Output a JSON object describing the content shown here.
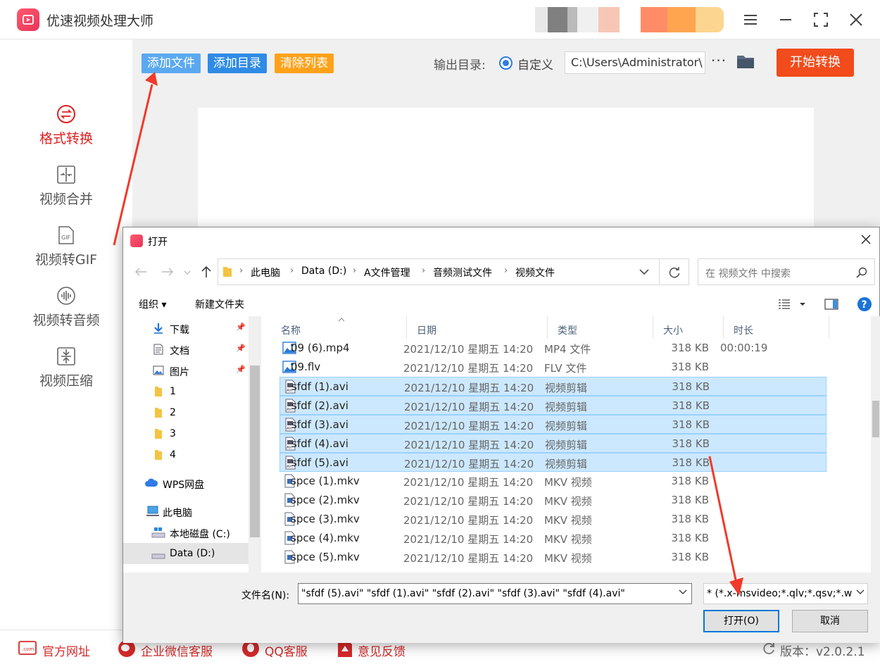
{
  "app": {
    "title": "优速视频处理大师"
  },
  "toolbar": {
    "add_file": "添加文件",
    "add_folder": "添加目录",
    "clear_list": "清除列表",
    "output_label": "输出目录:",
    "custom_label": "自定义",
    "output_path": "C:\\Users\\Administrator\\",
    "more": "···",
    "start": "开始转换"
  },
  "sidebar": {
    "items": [
      {
        "label": "格式转换",
        "icon": "convert-icon",
        "active": true
      },
      {
        "label": "视频合并",
        "icon": "merge-icon",
        "active": false
      },
      {
        "label": "视频转GIF",
        "icon": "gif-icon",
        "active": false
      },
      {
        "label": "视频转音频",
        "icon": "audio-wave-icon",
        "active": false
      },
      {
        "label": "视频压缩",
        "icon": "compress-icon",
        "active": false
      }
    ]
  },
  "footer": {
    "website": "官方网址",
    "wechat": "企业微信客服",
    "qq": "QQ客服",
    "feedback": "意见反馈",
    "version": "版本：v2.0.2.1"
  },
  "dialog": {
    "title": "打开",
    "breadcrumb": [
      "此电脑",
      "Data (D:)",
      "A文件管理",
      "音频测试文件",
      "视频文件"
    ],
    "search_placeholder": "在 视频文件 中搜索",
    "organize": "组织 ▾",
    "new_folder": "新建文件夹",
    "nav": [
      {
        "label": "下载",
        "icon": "download-icon",
        "pinned": true
      },
      {
        "label": "文档",
        "icon": "document-icon",
        "pinned": true
      },
      {
        "label": "图片",
        "icon": "picture-icon",
        "pinned": true
      },
      {
        "label": "1",
        "icon": "folder-icon",
        "pinned": false
      },
      {
        "label": "2",
        "icon": "folder-icon",
        "pinned": false
      },
      {
        "label": "3",
        "icon": "folder-icon",
        "pinned": false
      },
      {
        "label": "4",
        "icon": "folder-icon",
        "pinned": false
      },
      {
        "label": "WPS网盘",
        "icon": "cloud-icon",
        "pinned": false
      },
      {
        "label": "此电脑",
        "icon": "computer-icon",
        "pinned": false
      },
      {
        "label": "本地磁盘 (C:)",
        "icon": "drive-icon",
        "pinned": false
      },
      {
        "label": "Data (D:)",
        "icon": "drive-icon",
        "pinned": false,
        "selected": true
      }
    ],
    "columns": [
      "名称",
      "日期",
      "类型",
      "大小",
      "时长"
    ],
    "files": [
      {
        "name": "09 (6).mp4",
        "date": "2021/12/10 星期五 14:20",
        "type": "MP4 文件",
        "size": "318 KB",
        "duration": "00:00:19",
        "icon": "image-file-icon",
        "selected": false
      },
      {
        "name": "09.flv",
        "date": "2021/12/10 星期五 14:20",
        "type": "FLV 文件",
        "size": "318 KB",
        "duration": "",
        "icon": "image-file-icon",
        "selected": false
      },
      {
        "name": "sfdf (1).avi",
        "date": "2021/12/10 星期五 14:20",
        "type": "视频剪辑",
        "size": "318 KB",
        "duration": "",
        "icon": "avi-file-icon",
        "selected": true
      },
      {
        "name": "sfdf (2).avi",
        "date": "2021/12/10 星期五 14:20",
        "type": "视频剪辑",
        "size": "318 KB",
        "duration": "",
        "icon": "avi-file-icon",
        "selected": true
      },
      {
        "name": "sfdf (3).avi",
        "date": "2021/12/10 星期五 14:20",
        "type": "视频剪辑",
        "size": "318 KB",
        "duration": "",
        "icon": "avi-file-icon",
        "selected": true
      },
      {
        "name": "sfdf (4).avi",
        "date": "2021/12/10 星期五 14:20",
        "type": "视频剪辑",
        "size": "318 KB",
        "duration": "",
        "icon": "avi-file-icon",
        "selected": true
      },
      {
        "name": "sfdf (5).avi",
        "date": "2021/12/10 星期五 14:20",
        "type": "视频剪辑",
        "size": "318 KB",
        "duration": "",
        "icon": "avi-file-icon",
        "selected": true
      },
      {
        "name": "spce (1).mkv",
        "date": "2021/12/10 星期五 14:20",
        "type": "MKV 视频",
        "size": "318 KB",
        "duration": "",
        "icon": "mkv-file-icon",
        "selected": false
      },
      {
        "name": "spce (2).mkv",
        "date": "2021/12/10 星期五 14:20",
        "type": "MKV 视频",
        "size": "318 KB",
        "duration": "",
        "icon": "mkv-file-icon",
        "selected": false
      },
      {
        "name": "spce (3).mkv",
        "date": "2021/12/10 星期五 14:20",
        "type": "MKV 视频",
        "size": "318 KB",
        "duration": "",
        "icon": "mkv-file-icon",
        "selected": false
      },
      {
        "name": "spce (4).mkv",
        "date": "2021/12/10 星期五 14:20",
        "type": "MKV 视频",
        "size": "318 KB",
        "duration": "",
        "icon": "mkv-file-icon",
        "selected": false
      },
      {
        "name": "spce (5).mkv",
        "date": "2021/12/10 星期五 14:20",
        "type": "MKV 视频",
        "size": "318 KB",
        "duration": "",
        "icon": "mkv-file-icon",
        "selected": false
      }
    ],
    "filename_label": "文件名(N):",
    "filename_value": "\"sfdf (5).avi\" \"sfdf (1).avi\" \"sfdf (2).avi\" \"sfdf (3).avi\" \"sfdf (4).avi\"",
    "filetype_value": "* (*.x-msvideo;*.qlv;*.qsv;*.w",
    "open_button": "打开(O)",
    "cancel_button": "取消"
  },
  "colors": {
    "add_file_bg": "#5aa9f0",
    "add_folder_bg": "#2f8be6",
    "clear_bg": "#ffa21a",
    "start_bg": "#f24b1c",
    "active_red": "#e02020",
    "selection_bg": "#cce8ff",
    "annotation_arrow": "#f03a2a"
  }
}
